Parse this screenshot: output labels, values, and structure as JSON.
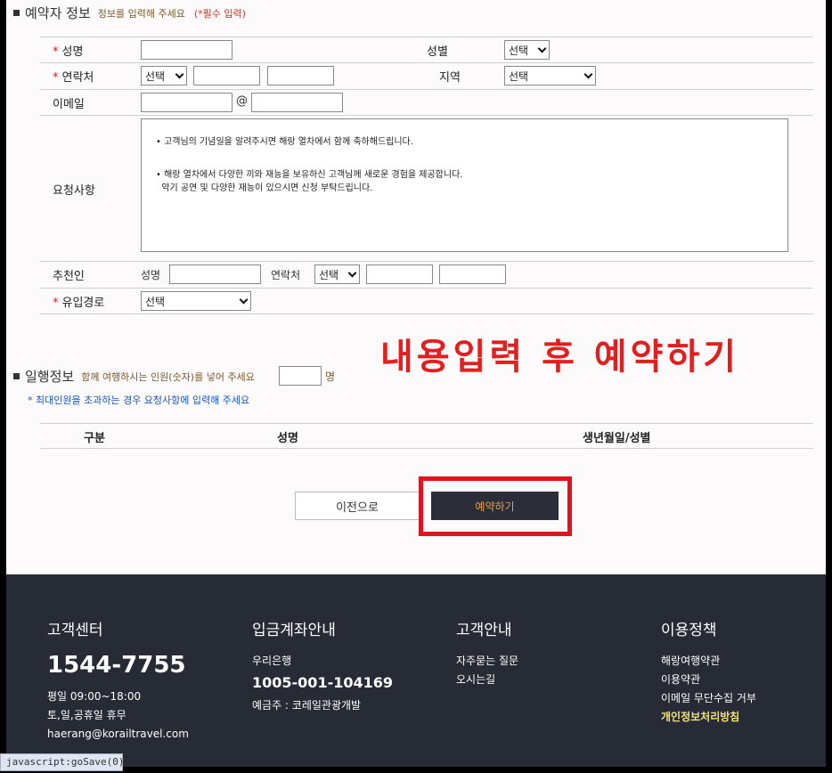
{
  "reservation": {
    "title": "예약자 정보",
    "hint": "정보를 입력해 주세요",
    "required_note": "(*필수 입력)",
    "name_label": "성명",
    "gender_label": "성별",
    "gender_select": "선택",
    "contact_label": "연락처",
    "contact_select": "선택",
    "region_label": "지역",
    "region_select": "선택",
    "email_label": "이메일",
    "at_sign": "@",
    "request_label": "요청사항",
    "request_lines": [
      "• 고객님의 기념일을 알려주시면 해랑 열차에서 함께 축하해드립니다.",
      "• 해랑 열차에서 다양한 끼와 재능을 보유하신 고객님께 새로운 경험을 제공합니다.",
      "  악기 공연 및 다양한 재능이 있으시면 신청 부탁드립니다."
    ],
    "referrer_label": "추천인",
    "ref_name_label": "성명",
    "ref_contact_label": "연락처",
    "ref_contact_select": "선택",
    "channel_label": "유입경로",
    "channel_select": "선택"
  },
  "promo_text": "내용입력 후 예약하기",
  "party": {
    "title": "일행정보",
    "hint": "함께 여행하시는 인원(숫자)를 넣어 주세요",
    "unit": "명",
    "note": "* 최대인원을 초과하는 경우 요청사항에 입력해 주세요",
    "columns": [
      "구분",
      "성명",
      "생년월일/성별"
    ]
  },
  "buttons": {
    "prev": "이전으로",
    "book": "예약하기"
  },
  "footer": {
    "cs": {
      "title": "고객센터",
      "phone": "1544-7755",
      "hours1": "평일 09:00~18:00",
      "hours2": "토,일,공휴일 휴무",
      "email": "haerang@korailtravel.com"
    },
    "bank": {
      "title": "입금계좌안내",
      "bank": "우리은행",
      "account": "1005-001-104169",
      "holder": "예금주 : 코레일관광개발"
    },
    "guide": {
      "title": "고객안내",
      "faq": "자주묻는 질문",
      "map": "오시는길"
    },
    "policy": {
      "title": "이용정책",
      "terms1": "해랑여행약관",
      "terms2": "이용약관",
      "email_refuse": "이메일 무단수집 거부",
      "privacy": "개인정보처리방침"
    }
  },
  "status_text": "javascript:goSave(0);"
}
